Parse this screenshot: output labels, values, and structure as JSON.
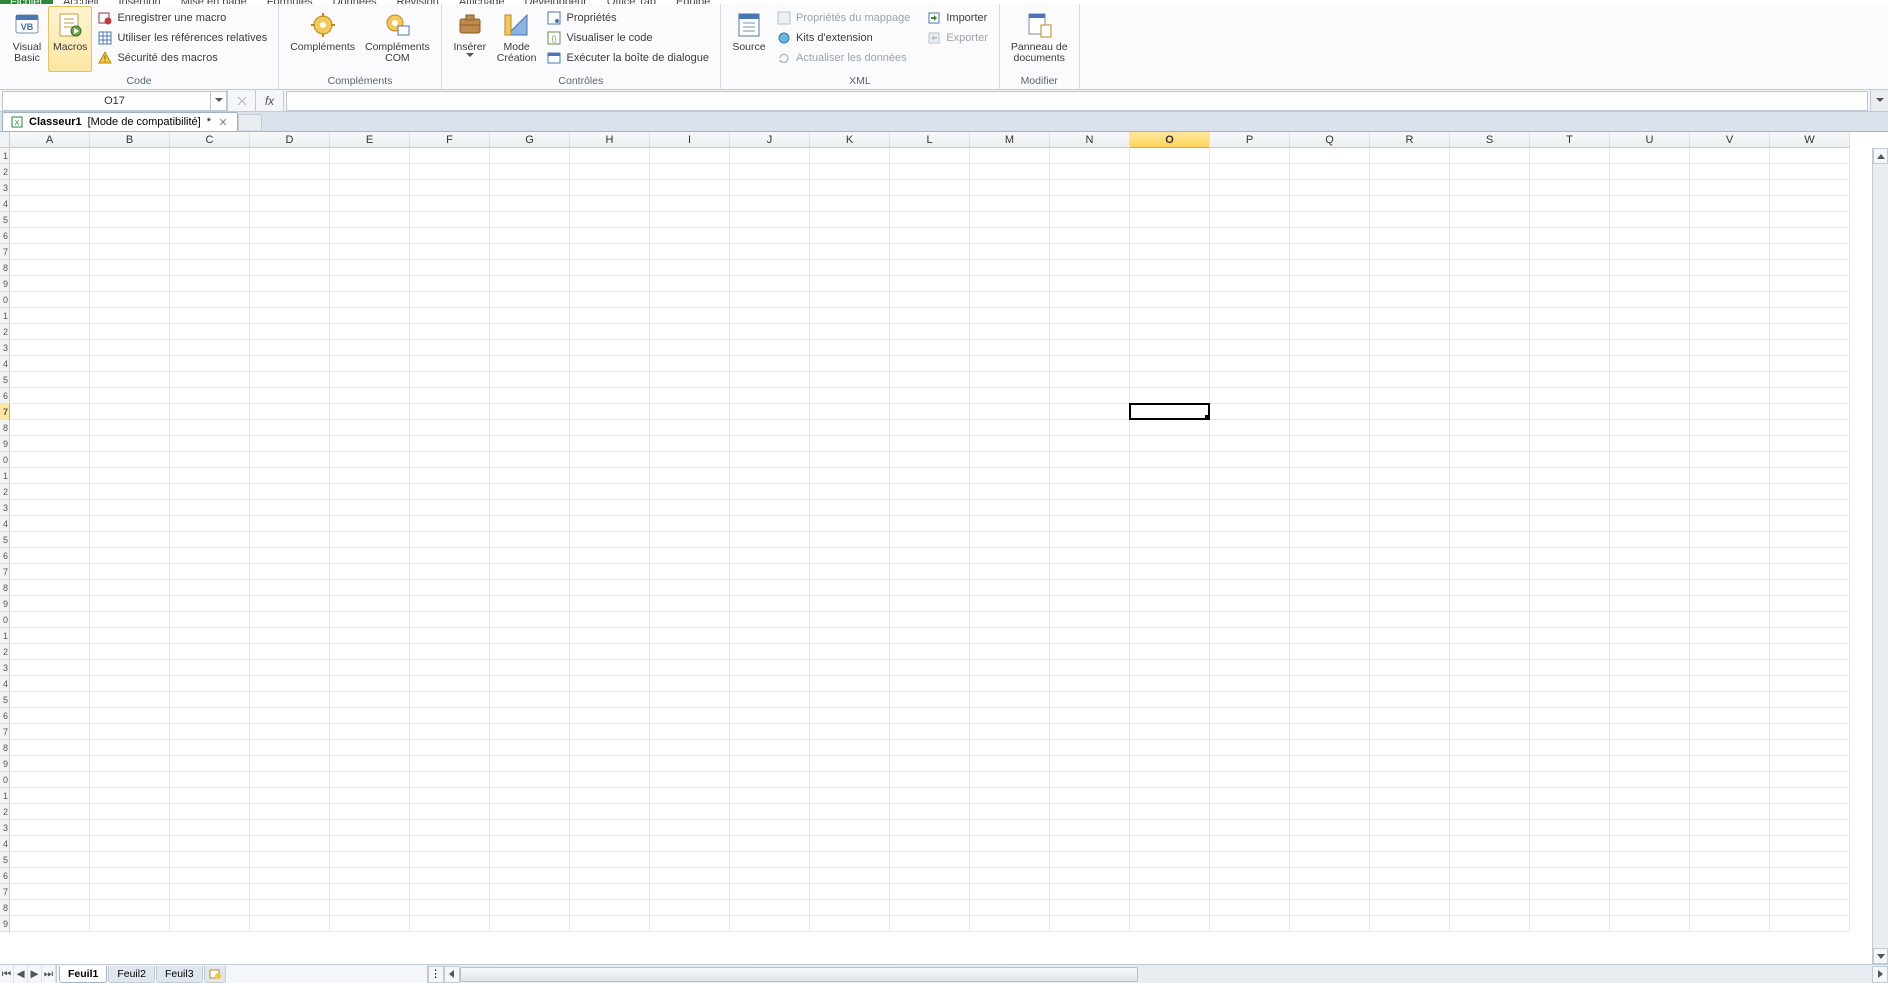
{
  "menu": [
    "Fichier",
    "Accueil",
    "Insertion",
    "Mise en page",
    "Formules",
    "Données",
    "Révision",
    "Affichage",
    "Développeur",
    "Office Tab",
    "Équipe"
  ],
  "ribbon": {
    "code": {
      "title": "Code",
      "visual_basic": "Visual\nBasic",
      "macros": "Macros",
      "record": "Enregistrer une macro",
      "relative": "Utiliser les références relatives",
      "security": "Sécurité des macros"
    },
    "addins": {
      "title": "Compléments",
      "comp": "Compléments",
      "com": "Compléments\nCOM"
    },
    "controls": {
      "title": "Contrôles",
      "insert": "Insérer",
      "design": "Mode\nCréation",
      "props": "Propriétés",
      "view_code": "Visualiser le code",
      "dialog": "Exécuter la boîte de dialogue"
    },
    "xml": {
      "title": "XML",
      "source": "Source",
      "map_props": "Propriétés du mappage",
      "ext_kits": "Kits d'extension",
      "refresh": "Actualiser les données",
      "import": "Importer",
      "export": "Exporter"
    },
    "modify": {
      "title": "Modifier",
      "doc_panel": "Panneau de\ndocuments"
    }
  },
  "name_box": "O17",
  "formula": "",
  "workbook_tab": {
    "name": "Classeur1",
    "mode": "[Mode de compatibilité]",
    "dirty": "*"
  },
  "columns": [
    "A",
    "B",
    "C",
    "D",
    "E",
    "F",
    "G",
    "H",
    "I",
    "J",
    "K",
    "L",
    "M",
    "N",
    "O",
    "P",
    "Q",
    "R",
    "S",
    "T",
    "U",
    "V",
    "W"
  ],
  "selected_col_index": 14,
  "selected_row_index": 16,
  "sheet_tabs": [
    "Feuil1",
    "Feuil2",
    "Feuil3"
  ],
  "active_sheet": 0,
  "num_rows": 49
}
